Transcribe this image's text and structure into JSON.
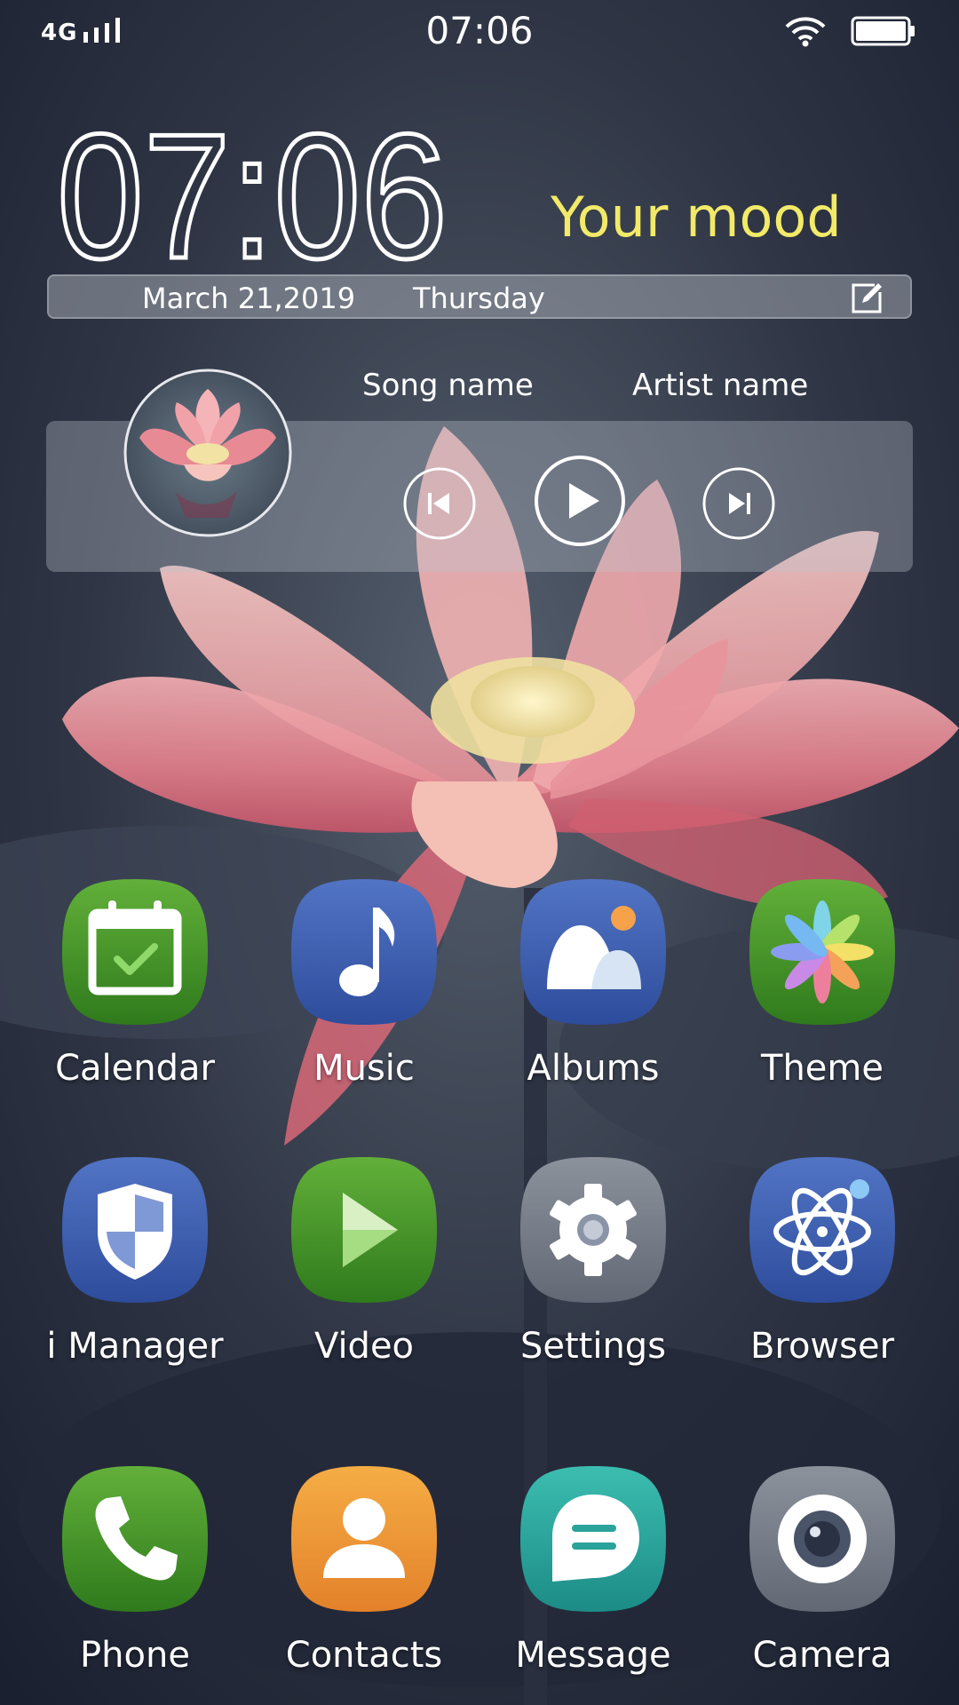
{
  "status_bar": {
    "network": "4G",
    "time": "07:06",
    "icons": [
      "signal-bars-icon",
      "wifi-icon",
      "battery-icon"
    ]
  },
  "clock_widget": {
    "time": "07:06",
    "mood": "Your mood",
    "date": "March 21,2019",
    "day": "Thursday",
    "edit_icon": "edit-icon"
  },
  "music_widget": {
    "song_name": "Song name",
    "artist_name": "Artist name",
    "controls": [
      "previous-track-icon",
      "play-icon",
      "next-track-icon"
    ]
  },
  "apps": [
    {
      "label": "Calendar",
      "icon": "calendar-icon"
    },
    {
      "label": "Music",
      "icon": "music-note-icon"
    },
    {
      "label": "Albums",
      "icon": "albums-icon"
    },
    {
      "label": "Theme",
      "icon": "theme-flower-icon"
    },
    {
      "label": "i Manager",
      "icon": "shield-icon"
    },
    {
      "label": "Video",
      "icon": "video-play-icon"
    },
    {
      "label": "Settings",
      "icon": "gear-icon"
    },
    {
      "label": "Browser",
      "icon": "atom-icon"
    },
    {
      "label": "Phone",
      "icon": "phone-icon"
    },
    {
      "label": "Contacts",
      "icon": "contact-person-icon"
    },
    {
      "label": "Message",
      "icon": "message-bubble-icon"
    },
    {
      "label": "Camera",
      "icon": "camera-lens-icon"
    }
  ],
  "colors": {
    "mood_text": "#f2ea68",
    "green_tile": "#4e9a2e",
    "blue_tile": "#3d5fb0",
    "gray_tile": "#7d838d",
    "orange_tile": "#ee9a38",
    "teal_tile": "#2aa39a"
  }
}
